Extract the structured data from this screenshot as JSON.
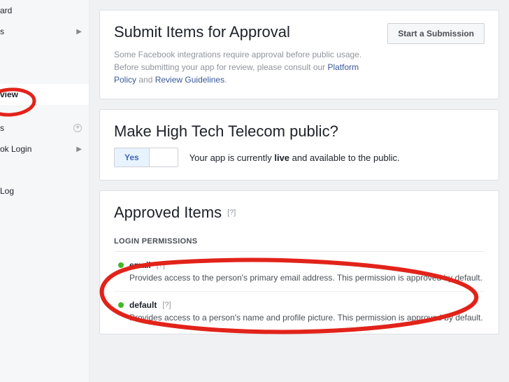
{
  "sidebar": {
    "items": [
      {
        "label": "ard",
        "kind": "text"
      },
      {
        "label": "s",
        "kind": "arrow"
      },
      {
        "label": "view",
        "kind": "active"
      },
      {
        "label": "s",
        "kind": "plus"
      },
      {
        "label": "ok Login",
        "kind": "arrow"
      },
      {
        "label": " Log",
        "kind": "text"
      }
    ]
  },
  "submit": {
    "title": "Submit Items for Approval",
    "desc_pre": "Some Facebook integrations require approval before public usage. Before submitting your app for review, please consult our ",
    "link1": "Platform Policy",
    "and": " and ",
    "link2": "Review Guidelines",
    "period": ".",
    "button": "Start a Submission"
  },
  "public": {
    "title": "Make High Tech Telecom public?",
    "yes": "Yes",
    "status_pre": "Your app is currently ",
    "status_bold": "live",
    "status_post": " and available to the public."
  },
  "approved": {
    "title": "Approved Items",
    "help": "[?]",
    "section": "LOGIN PERMISSIONS",
    "perms": [
      {
        "name": "email",
        "help": "[?]",
        "desc": "Provides access to the person's primary email address. This permission is approved by default."
      },
      {
        "name": "default",
        "help": "[?]",
        "desc": "Provides access to a person's name and profile picture. This permission is approved by default."
      }
    ]
  }
}
